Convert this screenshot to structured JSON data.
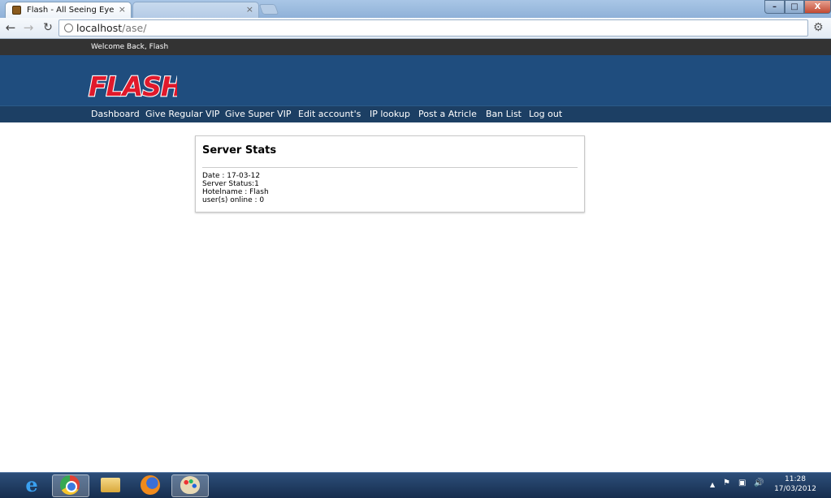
{
  "browser": {
    "tabs": [
      {
        "title": "Flash - All Seeing Eye",
        "close": "×"
      },
      {
        "title": "",
        "close": "×"
      }
    ],
    "window_buttons": {
      "minimize": "–",
      "maximize": "□",
      "close": "X"
    },
    "url_host": "localhost",
    "url_path": "/ase/"
  },
  "site": {
    "welcome_text": "Welcome Back, Flash",
    "logo_text": "FLASH",
    "nav": [
      "Dashboard",
      "Give Regular VIP",
      "Give Super VIP",
      "Edit account's",
      "IP lookup",
      "Post a Atricle",
      "Ban List",
      "Log out"
    ]
  },
  "stats": {
    "title": "Server Stats",
    "lines": [
      "Date : 17-03-12",
      "Server Status:1",
      "Hotelname : Flash",
      "user(s) online : 0"
    ]
  },
  "taskbar": {
    "time": "11:28",
    "date": "17/03/2012"
  },
  "colors": {
    "banner": "#1f4d7e",
    "navbar": "#1c3f64",
    "welcome_bar": "#333333",
    "logo_red": "#e0192b"
  },
  "icons": [
    "favicon-icon",
    "back-icon",
    "forward-icon",
    "reload-icon",
    "globe-icon",
    "wrench-icon",
    "ie-icon",
    "chrome-icon",
    "folder-icon",
    "firefox-icon",
    "paint-icon",
    "flag-icon",
    "network-icon",
    "volume-icon"
  ]
}
